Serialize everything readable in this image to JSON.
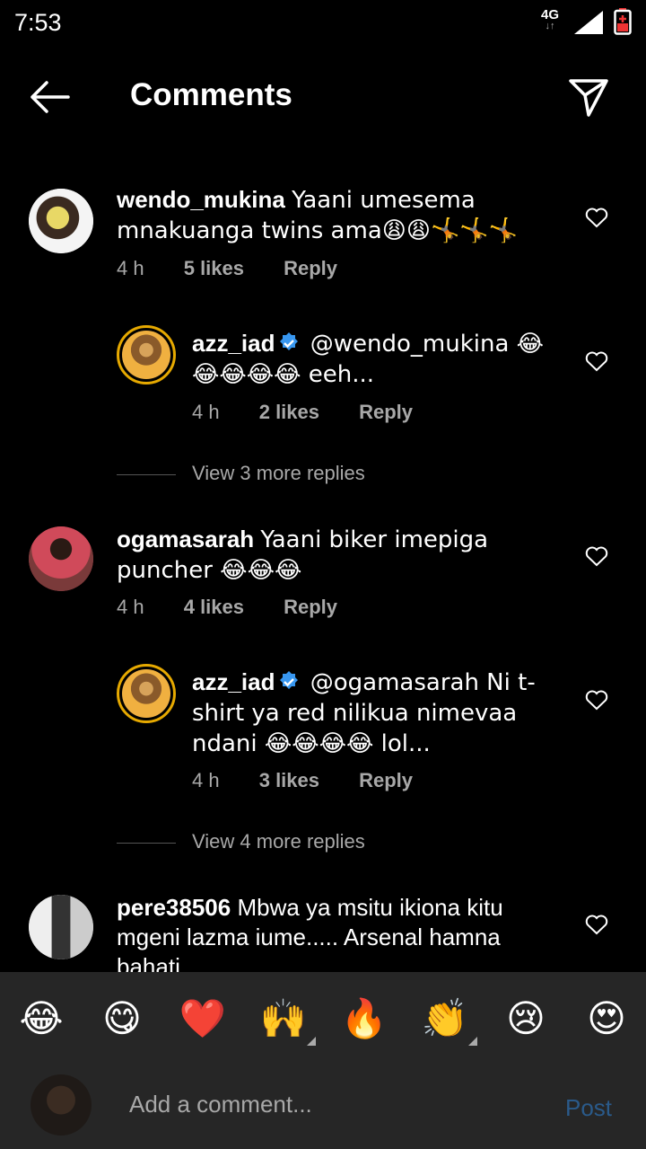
{
  "status": {
    "time": "7:53",
    "network": "4G",
    "network_arrows": "↓↑"
  },
  "header": {
    "title": "Comments"
  },
  "comments": [
    {
      "user": "wendo_mukina",
      "text": "Yaani umesema mnakuanga twins ama😩😩🤸🤸🤸",
      "time": "4 h",
      "likes": "5 likes",
      "reply": "Reply",
      "is_reply": false,
      "verified": false
    },
    {
      "user": "azz_iad",
      "text": "@wendo_mukina 😂😂😂😂😂 eeh...",
      "time": "4 h",
      "likes": "2 likes",
      "reply": "Reply",
      "is_reply": true,
      "verified": true
    },
    {
      "view_more": "View 3 more replies"
    },
    {
      "user": "ogamasarah",
      "text": "Yaani biker imepiga puncher 😂😂😂",
      "time": "4 h",
      "likes": "4 likes",
      "reply": "Reply",
      "is_reply": false,
      "verified": false
    },
    {
      "user": "azz_iad",
      "text": "@ogamasarah Ni t-shirt ya red nilikua nimevaa ndani 😂😂😂😂 lol...",
      "time": "4 h",
      "likes": "3 likes",
      "reply": "Reply",
      "is_reply": true,
      "verified": true
    },
    {
      "view_more": "View 4 more replies"
    },
    {
      "user": "pere38506",
      "text": "Mbwa ya msitu ikiona kitu mgeni lazma iume..... Arsenal hamna bahati",
      "is_reply": false,
      "verified": false
    }
  ],
  "emoji_bar": [
    "😂",
    "😋",
    "❤️",
    "🙌",
    "🔥",
    "👏",
    "😢",
    "😍"
  ],
  "composer": {
    "placeholder": "Add a comment...",
    "post_label": "Post"
  },
  "colors": {
    "background": "#000000",
    "bar": "#262626",
    "muted": "#a8a8a8",
    "verified": "#3897f0",
    "post_disabled": "#2a5a8a",
    "story_ring": "#e6a900"
  }
}
